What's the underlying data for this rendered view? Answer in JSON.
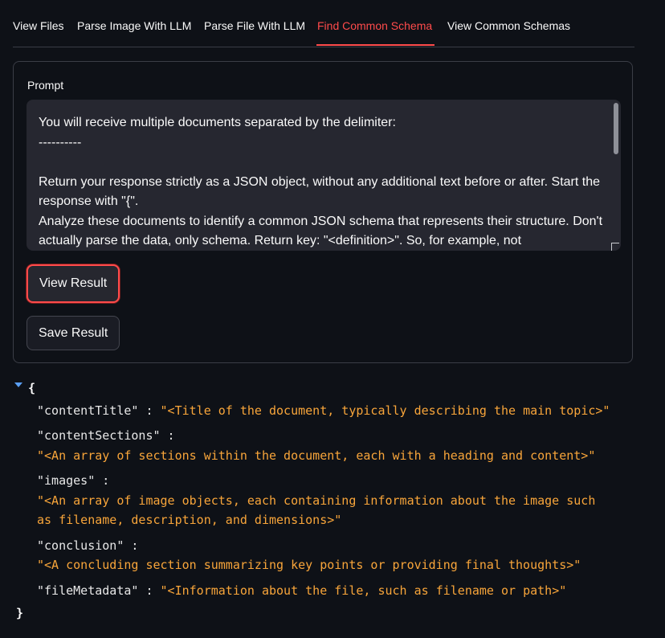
{
  "tabs": [
    {
      "label": "View Files",
      "active": false
    },
    {
      "label": "Parse Image With LLM",
      "active": false
    },
    {
      "label": "Parse File With LLM",
      "active": false
    },
    {
      "label": "Find Common Schema",
      "active": true
    },
    {
      "label": "View Common Schemas",
      "active": false
    }
  ],
  "prompt": {
    "label": "Prompt",
    "text": "You will receive multiple documents separated by the delimiter:\n----------\n\nReturn your response strictly as a JSON object, without any additional text before or after. Start the response with \"{\".\nAnalyze these documents to identify a common JSON schema that represents their structure. Don't actually parse the data, only schema. Return key: \"<definition>\". So, for example, not"
  },
  "buttons": {
    "view_result": "View Result",
    "save_result": "Save Result"
  },
  "result": {
    "open_brace": "{",
    "close_brace": "}",
    "entries": [
      {
        "key": "\"contentTitle\"",
        "value": "\"<Title of the document, typically describing the main topic>\""
      },
      {
        "key": "\"contentSections\"",
        "value": "\"<An array of sections within the document, each with a heading and content>\""
      },
      {
        "key": "\"images\"",
        "value_line1": "\"<An array of image objects, each containing information about the image such",
        "value_line2": "as filename, description, and dimensions>\""
      },
      {
        "key": "\"conclusion\"",
        "value": "\"<A concluding section summarizing key points or providing final thoughts>\""
      },
      {
        "key": "\"fileMetadata\"",
        "value": "\"<Information about the file, such as filename or path>\""
      }
    ],
    "separator": " : "
  },
  "colors": {
    "background": "#0e1117",
    "accent": "#ff4b4b",
    "json_value": "#f8a53a",
    "input_bg": "#262730"
  }
}
